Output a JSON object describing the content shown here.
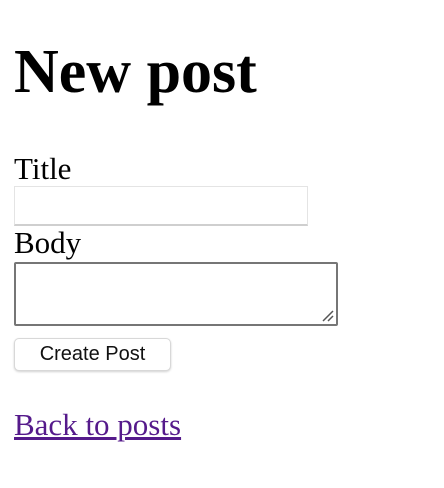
{
  "page": {
    "title": "New post"
  },
  "form": {
    "title_label": "Title",
    "title_value": "",
    "body_label": "Body",
    "body_value": "",
    "submit_label": "Create Post"
  },
  "navigation": {
    "back_link_label": "Back to posts"
  },
  "colors": {
    "visited_link": "#551a8b",
    "textarea_border": "#767676"
  },
  "icons": {
    "resize_grip": "resize-grip-icon"
  }
}
